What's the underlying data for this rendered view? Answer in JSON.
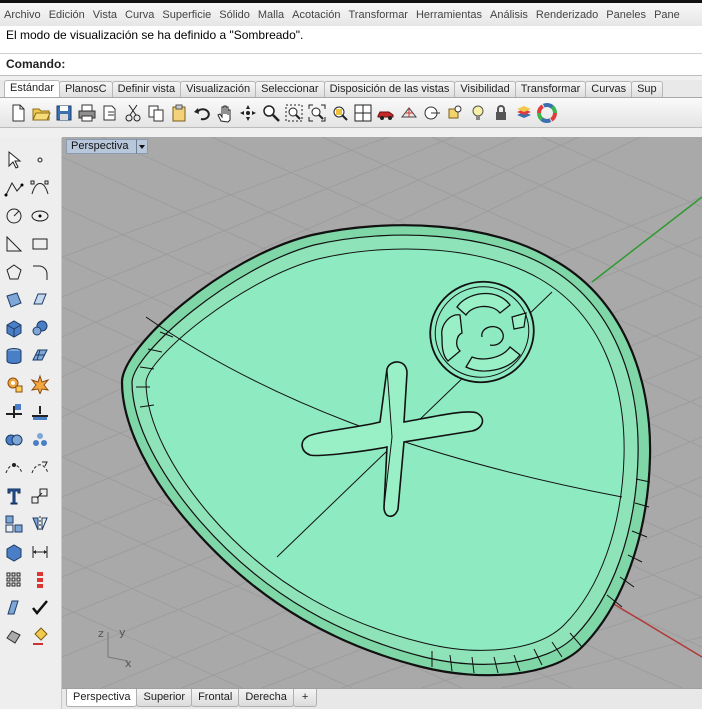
{
  "menubar": {
    "items": [
      "Archivo",
      "Edición",
      "Vista",
      "Curva",
      "Superficie",
      "Sólido",
      "Malla",
      "Acotación",
      "Transformar",
      "Herramientas",
      "Análisis",
      "Renderizado",
      "Paneles",
      "Pane"
    ]
  },
  "history": {
    "message": "El modo de visualización se ha definido a \"Sombreado\"."
  },
  "command": {
    "label": "Comando:",
    "value": ""
  },
  "tabs": {
    "items": [
      "Estándar",
      "PlanosC",
      "Definir vista",
      "Visualización",
      "Seleccionar",
      "Disposición de las vistas",
      "Visibilidad",
      "Transformar",
      "Curvas",
      "Sup"
    ],
    "active_index": 0
  },
  "toolbar": {
    "icons": [
      "new-file-icon",
      "open-folder-icon",
      "save-icon",
      "print-icon",
      "import-icon",
      "cut-icon",
      "copy-icon",
      "paste-icon",
      "undo-icon",
      "pan-hand-icon",
      "rotate-view-icon",
      "zoom-icon",
      "zoom-window-icon",
      "zoom-extents-icon",
      "zoom-selected-icon",
      "four-viewports-icon",
      "car-render-icon",
      "mesh-icon",
      "cplane-icon",
      "osnap-icon",
      "bulb-icon",
      "lock-icon",
      "layers-icon",
      "color-wheel-icon"
    ]
  },
  "viewport": {
    "label": "Perspectiva",
    "axis_x": "x",
    "axis_y": "y",
    "axis_z": "z",
    "colors": {
      "background": "#a9a9a9",
      "grid": "#9c9c9c",
      "model_fill": "#8fe3b8",
      "model_edge": "#111111",
      "axis_red": "#b23a3a",
      "axis_green": "#2f9a2f"
    }
  },
  "viewtabs": {
    "items": [
      "Perspectiva",
      "Superior",
      "Frontal",
      "Derecha",
      "+"
    ],
    "active_index": 0
  }
}
